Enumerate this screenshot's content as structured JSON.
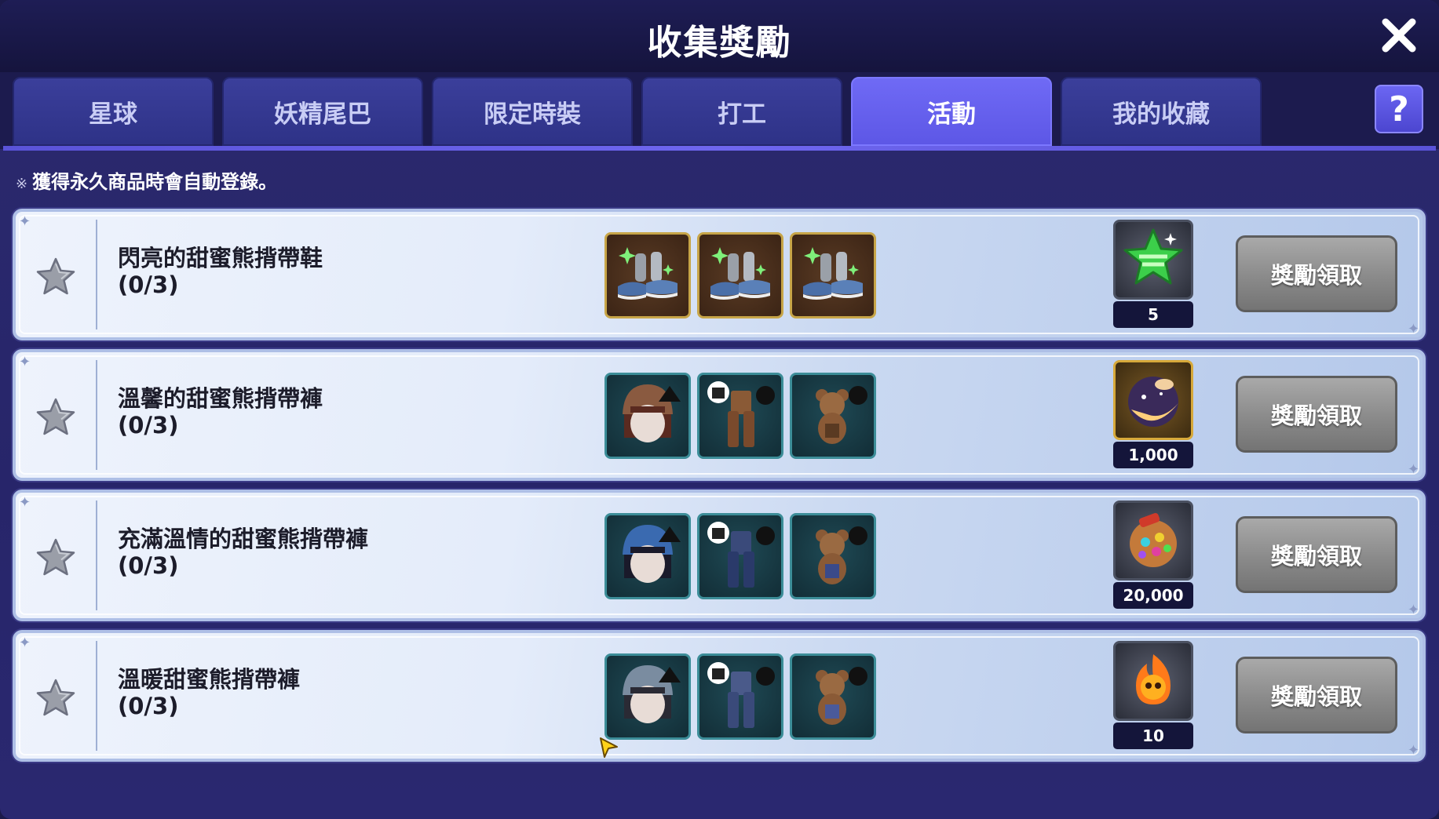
{
  "window": {
    "title": "收集獎勵"
  },
  "tabs": [
    {
      "label": "星球",
      "active": false
    },
    {
      "label": "妖精尾巴",
      "active": false
    },
    {
      "label": "限定時裝",
      "active": false
    },
    {
      "label": "打工",
      "active": false
    },
    {
      "label": "活動",
      "active": true
    },
    {
      "label": "我的收藏",
      "active": false
    }
  ],
  "help": {
    "label": "?"
  },
  "notice": {
    "mark": "※",
    "text": "獲得永久商品時會自動登錄。"
  },
  "rows": [
    {
      "name": "閃亮的甜蜜熊揹帶鞋",
      "progress": "(0/3)",
      "items": [
        "sparkle-shoes",
        "sparkle-shoes",
        "sparkle-shoes"
      ],
      "item_frame": "gold",
      "reward_icon": "green-star-icon",
      "reward_count": "5",
      "claim_label": "獎勵領取"
    },
    {
      "name": "溫馨的甜蜜熊揹帶褲",
      "progress": "(0/3)",
      "items": [
        "brown-beanie-hair",
        "brown-overalls",
        "brown-teddy-bear"
      ],
      "item_frame": "teal",
      "reward_icon": "moon-orb-icon",
      "reward_count": "1,000",
      "claim_label": "獎勵領取"
    },
    {
      "name": "充滿溫情的甜蜜熊揹帶褲",
      "progress": "(0/3)",
      "items": [
        "blue-beanie-hair",
        "navy-overalls",
        "blue-teddy-bear"
      ],
      "item_frame": "teal",
      "reward_icon": "candy-jar-icon",
      "reward_count": "20,000",
      "claim_label": "獎勵領取"
    },
    {
      "name": "溫暖甜蜜熊揹帶褲",
      "progress": "(0/3)",
      "items": [
        "grey-beanie-hair",
        "denim-overalls",
        "denim-teddy-bear"
      ],
      "item_frame": "teal",
      "reward_icon": "fire-spirit-icon",
      "reward_count": "10",
      "claim_label": "獎勵領取"
    }
  ],
  "colors": {
    "accent": "#6f6af5",
    "claim_button": "#8a8a8a",
    "background": "#27256a"
  }
}
